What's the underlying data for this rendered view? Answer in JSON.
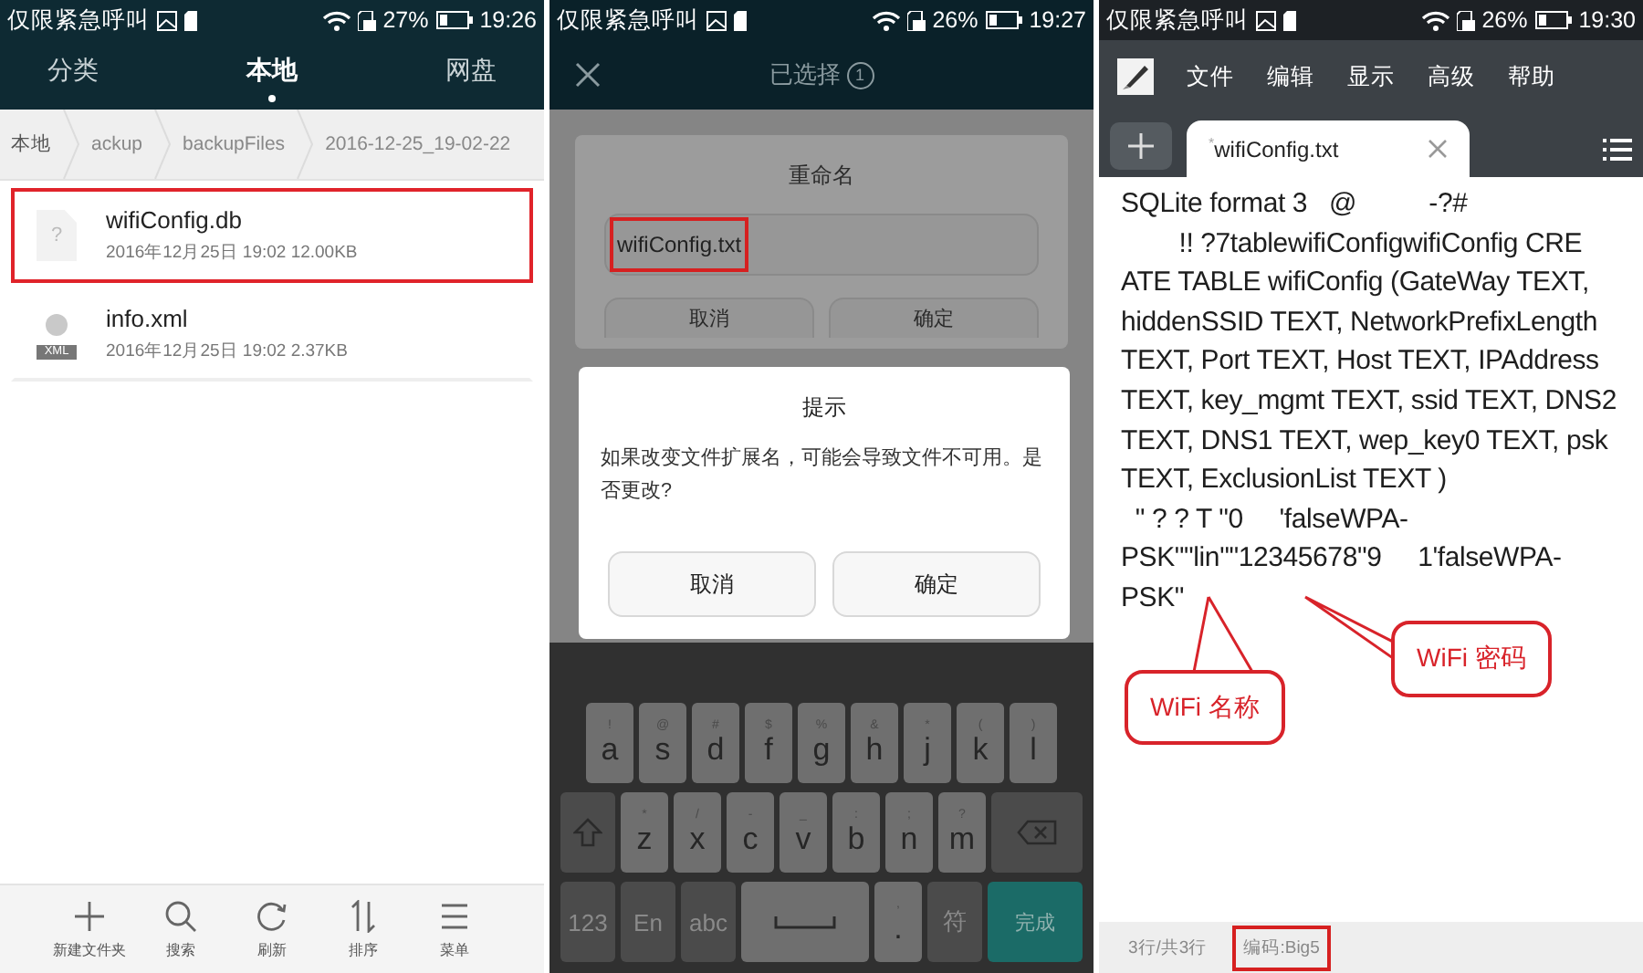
{
  "file_manager": {
    "status_bar": {
      "carrier": "仅限紧急呼叫",
      "battery": "27%",
      "time": "19:26"
    },
    "tabs": [
      {
        "label": "分类",
        "selected": false
      },
      {
        "label": "本地",
        "selected": true
      },
      {
        "label": "网盘",
        "selected": false
      }
    ],
    "breadcrumb": [
      "本地",
      "ackup",
      "backupFiles",
      "2016-12-25_19-02-22"
    ],
    "files": [
      {
        "name": "wifiConfig.db",
        "meta": "2016年12月25日 19:02 12.00KB",
        "kind": "unknown",
        "icon_text": "?",
        "highlighted": true
      },
      {
        "name": "info.xml",
        "meta": "2016年12月25日 19:02 2.37KB",
        "kind": "xml",
        "icon_text": "XML",
        "highlighted": false
      }
    ],
    "toolbar": [
      {
        "label": "新建文件夹",
        "kind": "plus"
      },
      {
        "label": "搜索",
        "kind": "search"
      },
      {
        "label": "刷新",
        "kind": "refresh"
      },
      {
        "label": "排序",
        "kind": "sort"
      },
      {
        "label": "菜单",
        "kind": "menu"
      }
    ]
  },
  "rename_screen": {
    "status_bar": {
      "carrier": "仅限紧急呼叫",
      "battery": "26%",
      "time": "19:27"
    },
    "header": {
      "title": "已选择",
      "count": "1"
    },
    "rename_dialog": {
      "title": "重命名",
      "value": "wifiConfig.txt",
      "highlighted": true,
      "buttons": [
        "取消",
        "确定"
      ]
    },
    "prompt_dialog": {
      "title": "提示",
      "message": "如果改变文件扩展名，可能会导致文件不可用。是否更改?",
      "buttons": [
        "取消",
        "确定"
      ]
    },
    "keyboard": {
      "middle_row": [
        {
          "kind": "letter",
          "label": "a",
          "hint": "!"
        },
        {
          "kind": "letter",
          "label": "s",
          "hint": "@"
        },
        {
          "kind": "letter",
          "label": "d",
          "hint": "#"
        },
        {
          "kind": "letter",
          "label": "f",
          "hint": "$"
        },
        {
          "kind": "letter",
          "label": "g",
          "hint": "%"
        },
        {
          "kind": "letter",
          "label": "h",
          "hint": "&"
        },
        {
          "kind": "letter",
          "label": "j",
          "hint": "*"
        },
        {
          "kind": "letter",
          "label": "k",
          "hint": "("
        },
        {
          "kind": "letter",
          "label": "l",
          "hint": ")"
        }
      ],
      "lower_row": [
        {
          "kind": "shift"
        },
        {
          "kind": "letter",
          "label": "z",
          "hint": "*"
        },
        {
          "kind": "letter",
          "label": "x",
          "hint": "/"
        },
        {
          "kind": "letter",
          "label": "c",
          "hint": "-"
        },
        {
          "kind": "letter",
          "label": "v",
          "hint": "_"
        },
        {
          "kind": "letter",
          "label": "b",
          "hint": ":"
        },
        {
          "kind": "letter",
          "label": "n",
          "hint": ";"
        },
        {
          "kind": "letter",
          "label": "m",
          "hint": "?"
        },
        {
          "kind": "backspace"
        }
      ],
      "bottom_row": [
        {
          "kind": "mode",
          "label": "123"
        },
        {
          "kind": "mode",
          "label": "En"
        },
        {
          "kind": "mode",
          "label": "abc"
        },
        {
          "kind": "space"
        },
        {
          "kind": "letter",
          "label": ".",
          "hint": ","
        },
        {
          "kind": "mode",
          "label": "符"
        },
        {
          "kind": "action",
          "label": "完成"
        }
      ]
    }
  },
  "text_editor": {
    "status_bar": {
      "carrier": "仅限紧急呼叫",
      "battery": "26%",
      "time": "19:30"
    },
    "menu": [
      "文件",
      "编辑",
      "显示",
      "高级",
      "帮助"
    ],
    "tab": {
      "title": "$^{*}$wifiConfig.txt"
    },
    "lines": [
      "SQLite format 3   @          -?#",
      "        !! ?7tablewifiConfigwifiConfig CRE",
      "ATE TABLE wifiConfig (GateWay TEXT,",
      "hiddenSSID TEXT, NetworkPrefixLength",
      "TEXT, Port TEXT, Host TEXT, IPAddress",
      "TEXT, key_mgmt TEXT, ssid TEXT, DNS2",
      "TEXT, DNS1 TEXT, wep_key0 TEXT, psk",
      "TEXT, ExclusionList TEXT )",
      "  \" ? ? T \"0     'falseWPA-",
      "PSK\"\"lin\"\"12345678\"9     1'falseWPA-",
      "PSK\""
    ],
    "callouts": [
      {
        "text": "WiFi 名称",
        "kind": "name"
      },
      {
        "text": "WiFi 密码",
        "kind": "password"
      }
    ],
    "footer": [
      {
        "text": "3行/共3行",
        "highlighted": false
      },
      {
        "text": "编码:Big5",
        "highlighted": true
      }
    ]
  }
}
